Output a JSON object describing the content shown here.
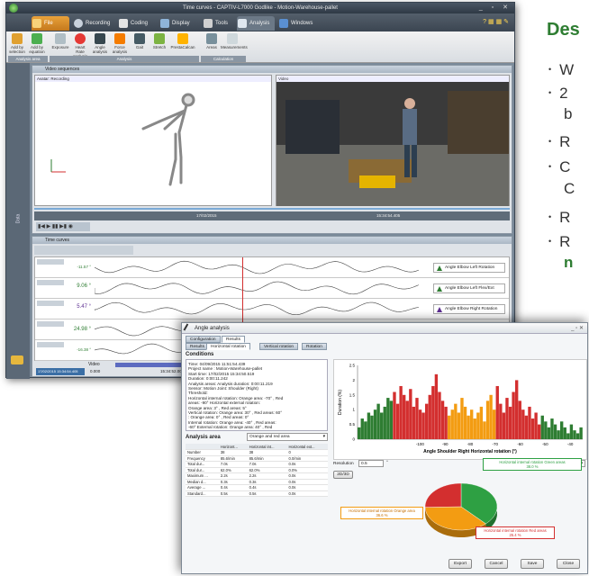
{
  "slide": {
    "title": "Des",
    "bullets": [
      "W",
      "2",
      "b",
      "R",
      "C",
      "C",
      "R",
      "R",
      "n"
    ]
  },
  "window1": {
    "title": "Time curves - CAPTIV-L7000 Godlike - Motion-Warehouse-pallet",
    "menu_tabs": [
      "File",
      "Recording",
      "Coding",
      "Display",
      "Tools",
      "Analysis",
      "Windows"
    ],
    "ribbon_buttons": [
      "Add by selection",
      "Add by equation",
      "Exposure",
      "Heart Rate analysis",
      "Angle analysis",
      "Force analysis",
      "Gait",
      "Stretch",
      "PrestaCalcan",
      "Areas",
      "Measurements"
    ],
    "ribbon_groups": [
      "Analysis area",
      "Analysis",
      "Calculation"
    ],
    "left_strip_label": "Data",
    "video_pane": {
      "title": "Video sequences",
      "avatar_label": "Avatar: Recording",
      "video_label": "Video",
      "date": "17/02/2015",
      "time": "15:34:54.405"
    },
    "curves_pane": {
      "title": "Time curves",
      "rows": [
        {
          "value": "-11.57 °",
          "label": "Angle Elbow Left Rotation",
          "color": "#2e7d32"
        },
        {
          "value": "9.06 °",
          "label": "Angle Elbow Left Flex/Ext",
          "color": "#2e7d32"
        },
        {
          "value": "5.47 °",
          "label": "Angle Elbow Right Rotation",
          "color": "#5c2d91"
        },
        {
          "value": "24.98 °",
          "label": "",
          "color": "#2e7d32"
        },
        {
          "value": "-16.38 °",
          "label": "",
          "color": "#2e7d32"
        }
      ],
      "video_track": "Video",
      "ruler_start": "0.000",
      "ruler_mid": "15:34:52.000",
      "bottom_date": "17/02/2015",
      "bottom_time": "15:34:54.405"
    }
  },
  "window2": {
    "title": "Angle analysis",
    "top_tabs": [
      "Configuration",
      "Results"
    ],
    "sub_tabs": [
      "Results",
      "Horizontal rotation",
      "Vertical rotation",
      "Rotation"
    ],
    "conditions_title": "Conditions",
    "conditions_lines": [
      "Time: 04/09/2015 11:51:54.439",
      "Project name : Motion-Warehouse-pallet",
      "Start time: 17/02/2015 15:34:50.519",
      "         Duration: 0:00:11.242",
      "Analysis areas:   Analysis duration: 0:00:11.219",
      "Sensor: Motion   Joint: Shoulder (Right)",
      "Threshold:",
      "Horizontal internal rotation: Orange area: -70° , Red",
      "areas: -90°      Horizontal external rotation:",
      "Orange area: 3° , Red areas: 5°",
      "Vertical rotation: Orange area: 30° , Red areas: 60°",
      "         : Orange area: 0° , Red areas: 0°",
      "Internal rotation: Orange area: -40° , Red areas:",
      "-60°     External rotation: Orange area: 40° , Red"
    ],
    "analysis_area_label": "Analysis area",
    "analysis_area_value": "Orange and red area",
    "table": {
      "headers": [
        "",
        "Horizont...",
        "Horizontal int...",
        "Horizontal ext..."
      ],
      "rows": [
        [
          "Number",
          "38",
          "38",
          "0"
        ],
        [
          "Frequency",
          "85.6/min",
          "85.6/min",
          "0.0/min"
        ],
        [
          "Total dur...",
          "7.0s",
          "7.0s",
          "0.0s"
        ],
        [
          "Total dur...",
          "62.0%",
          "62.0%",
          "0.0%"
        ],
        [
          "Maximum ...",
          "2.2s",
          "2.2s",
          "0.0s"
        ],
        [
          "Median d...",
          "0.3s",
          "0.3s",
          "0.0s"
        ],
        [
          "Average ...",
          "0.4s",
          "0.4s",
          "0.0s"
        ],
        [
          "Standard...",
          "0.5s",
          "0.5s",
          "0.0s"
        ]
      ]
    },
    "resolution_label": "Resolution",
    "resolution_value": "0.5",
    "resolution_unit": "°",
    "chart_type_select": "Bar Chart",
    "toggle_2d3d": "2D/3D",
    "pie_callouts": {
      "green": "Horizontal internal rotation Green areas\n38.0 %",
      "orange": "Horizontal internal rotation Orange area\n36.6 %",
      "red": "Horizontal internal rotation Red areas\n25.4 %"
    },
    "buttons": [
      "Export",
      "Cancel",
      "Save",
      "Close"
    ]
  },
  "chart_data": [
    {
      "type": "bar",
      "title": "",
      "xlabel": "Angle Shoulder Right Horizontal rotation (°)",
      "ylabel": "Duration (%)",
      "xlim": [
        -125,
        -35
      ],
      "ylim": [
        0,
        2.5
      ],
      "x_ticks": [
        "-100",
        "-90",
        "-80",
        "-70",
        "-60",
        "-50",
        "-40"
      ],
      "y_ticks": [
        "0",
        "0.5",
        "1",
        "1.5",
        "2",
        "2.5"
      ],
      "grid": false,
      "zones": [
        {
          "color": "#2e7d32",
          "range": [
            -125,
            -112
          ]
        },
        {
          "color": "#d32f2f",
          "range": [
            -112,
            -90
          ]
        },
        {
          "color": "#f39c12",
          "range": [
            -90,
            -70
          ]
        },
        {
          "color": "#d32f2f",
          "range": [
            -70,
            -52
          ]
        },
        {
          "color": "#2e7d32",
          "range": [
            -52,
            -35
          ]
        }
      ],
      "heights": [
        0.4,
        0.7,
        0.6,
        0.9,
        0.8,
        1.0,
        1.2,
        0.9,
        1.1,
        1.4,
        1.3,
        1.6,
        1.2,
        1.8,
        1.5,
        1.3,
        1.7,
        1.1,
        1.4,
        1.0,
        0.9,
        1.2,
        1.5,
        1.8,
        2.2,
        1.6,
        1.3,
        1.1,
        0.8,
        1.0,
        1.2,
        0.9,
        1.4,
        1.1,
        0.8,
        1.0,
        0.7,
        0.9,
        1.1,
        0.6,
        1.3,
        1.5,
        1.0,
        1.8,
        1.2,
        0.9,
        1.4,
        1.1,
        1.6,
        2.0,
        1.3,
        1.0,
        0.8,
        1.1,
        0.7,
        0.9,
        0.5,
        0.8,
        0.6,
        0.4,
        0.7,
        0.5,
        0.3,
        0.6,
        0.4,
        0.2,
        0.5,
        0.3,
        0.2,
        0.4
      ]
    },
    {
      "type": "pie",
      "title": "",
      "categories": [
        "Green areas",
        "Orange area",
        "Red areas"
      ],
      "values": [
        38.0,
        36.6,
        25.4
      ],
      "colors": [
        "#2ea043",
        "#f39c12",
        "#d32f2f"
      ]
    }
  ]
}
